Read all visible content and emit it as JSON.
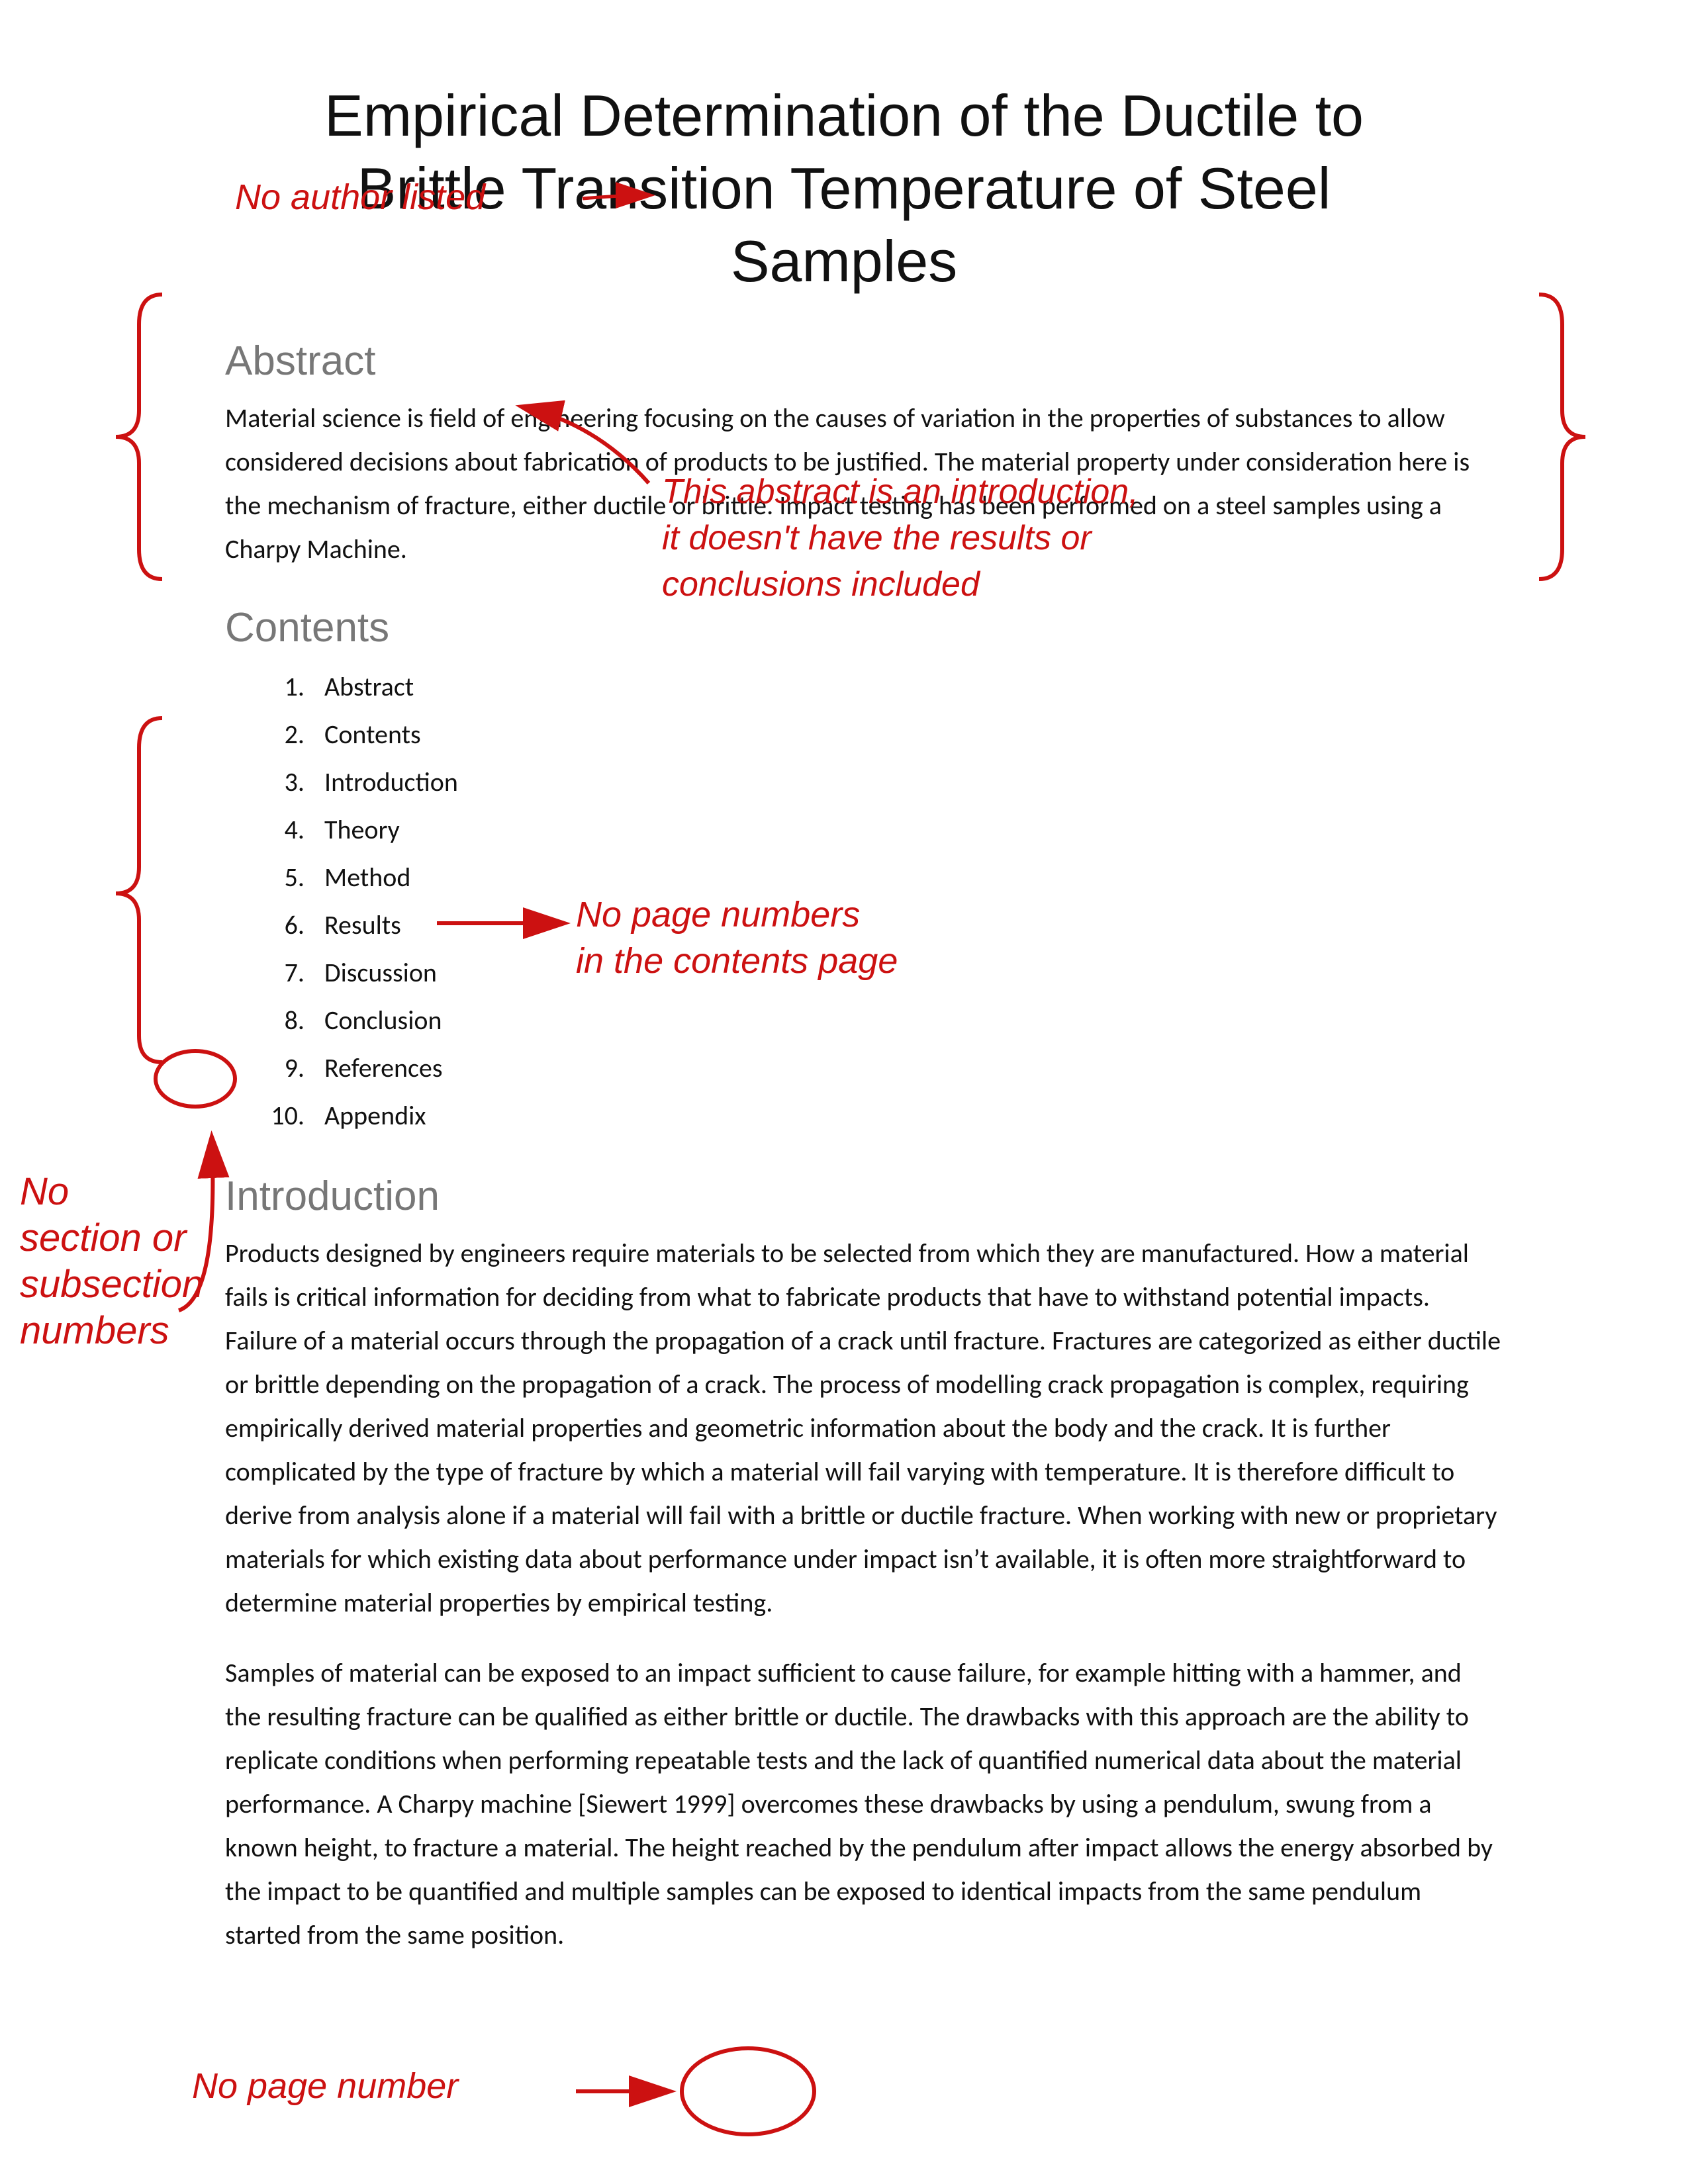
{
  "title": {
    "line1": "Empirical Determination of the Ductile to",
    "line2": "Brittle Transition Temperature of Steel",
    "line3": "Samples"
  },
  "annotations": {
    "no_author": "No author listed",
    "abstract_comment_line1": "This abstract is an introduction,",
    "abstract_comment_line2": "it doesn’t have the results or",
    "abstract_comment_line3": "conclusions included",
    "no_page_numbers_line1": "No page numbers",
    "no_page_numbers_line2": "in the contents page",
    "no_section_line1": "No",
    "no_section_line2": "section or",
    "no_section_line3": "subsection",
    "no_section_line4": "numbers",
    "no_page_number_bottom": "No page number"
  },
  "abstract": {
    "heading": "Abstract",
    "body": "Material science is field of engineering focusing on the causes of variation in the properties of substances to allow considered decisions about fabrication of products to be justified. The material property under consideration here is the mechanism of fracture, either ductile or brittle.  Impact testing has been performed on a steel samples using a Charpy Machine."
  },
  "contents": {
    "heading": "Contents",
    "items": [
      {
        "num": "1.",
        "label": "Abstract"
      },
      {
        "num": "2.",
        "label": "Contents"
      },
      {
        "num": "3.",
        "label": "Introduction"
      },
      {
        "num": "4.",
        "label": "Theory"
      },
      {
        "num": "5.",
        "label": "Method"
      },
      {
        "num": "6.",
        "label": "Results"
      },
      {
        "num": "7.",
        "label": "Discussion"
      },
      {
        "num": "8.",
        "label": "Conclusion"
      },
      {
        "num": "9.",
        "label": "References"
      },
      {
        "num": "10.",
        "label": "Appendix"
      }
    ]
  },
  "introduction": {
    "heading": "Introduction",
    "para1": "Products designed by engineers require materials to be selected from which they are manufactured. How a material fails is critical information for deciding from what to fabricate products that have to withstand potential impacts. Failure of a material occurs through the propagation of a crack until fracture. Fractures are categorized as either ductile or brittle depending on the propagation of a crack. The process of modelling crack propagation is complex, requiring empirically derived material properties and geometric information about the body and the crack. It is further complicated by the type of fracture by which a material will fail varying with temperature. It is therefore difficult to derive from analysis alone if a material will fail with a brittle or ductile fracture. When working with new or proprietary materials for which existing data about performance under impact isn’t available, it is often more straightforward to determine material properties by empirical testing.",
    "para2": "Samples of material can be exposed to an impact sufficient to cause failure, for example hitting with a hammer, and the resulting fracture can be qualified as either brittle or ductile. The drawbacks with this approach are the ability to replicate conditions when performing repeatable tests and the lack of quantified numerical data about the material performance. A Charpy machine [Siewert 1999] overcomes these drawbacks by using a pendulum, swung from a known height, to fracture a material. The height reached by the pendulum after impact allows the energy absorbed by the impact to be quantified and multiple samples can be exposed to identical impacts from the same pendulum started from the same position."
  }
}
